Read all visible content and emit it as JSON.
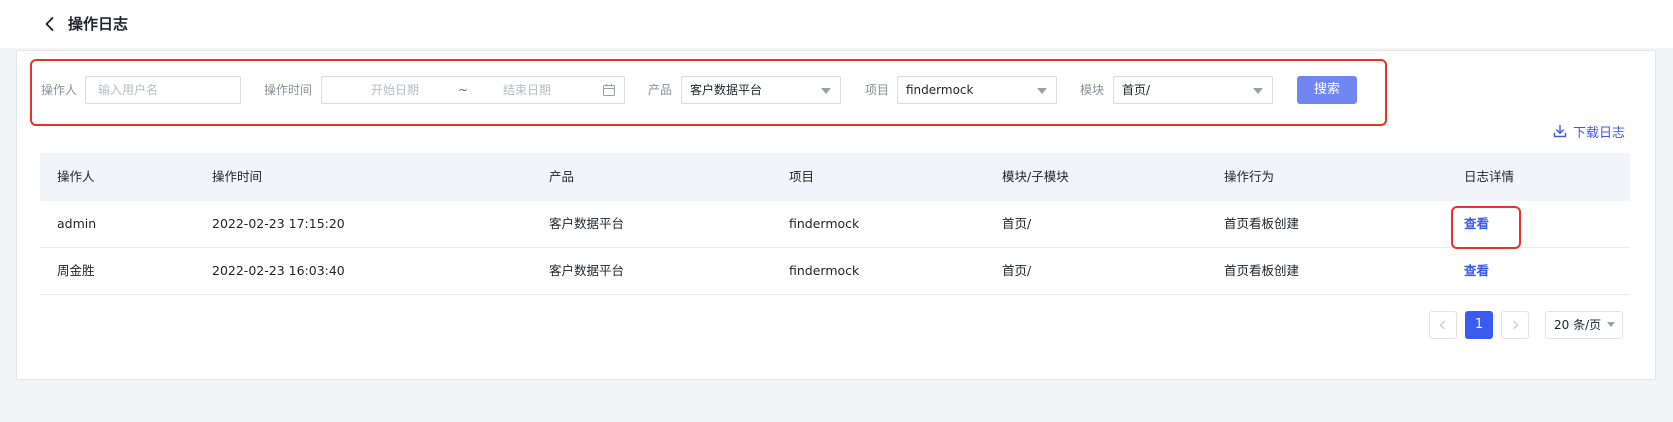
{
  "header": {
    "title": "操作日志"
  },
  "filters": {
    "operator_label": "操作人",
    "operator_placeholder": "输入用户名",
    "time_label": "操作时间",
    "start_placeholder": "开始日期",
    "separator": "~",
    "end_placeholder": "结束日期",
    "product_label": "产品",
    "product_value": "客户数据平台",
    "project_label": "项目",
    "project_value": "findermock",
    "module_label": "模块",
    "module_value": "首页/",
    "search_label": "搜索"
  },
  "download_label": "下载日志",
  "table": {
    "columns": [
      "操作人",
      "操作时间",
      "产品",
      "项目",
      "模块/子模块",
      "操作行为",
      "日志详情"
    ],
    "rows": [
      [
        "admin",
        "2022-02-23 17:15:20",
        "客户数据平台",
        "findermock",
        "首页/",
        "首页看板创建",
        "查看"
      ],
      [
        "周金胜",
        "2022-02-23 16:03:40",
        "客户数据平台",
        "findermock",
        "首页/",
        "首页看板创建",
        "查看"
      ]
    ]
  },
  "pagination": {
    "current": "1",
    "page_size": "20 条/页"
  },
  "colors": {
    "accent": "#3b5bf0",
    "highlight": "#e8322a",
    "search_button": "#7086f3"
  }
}
